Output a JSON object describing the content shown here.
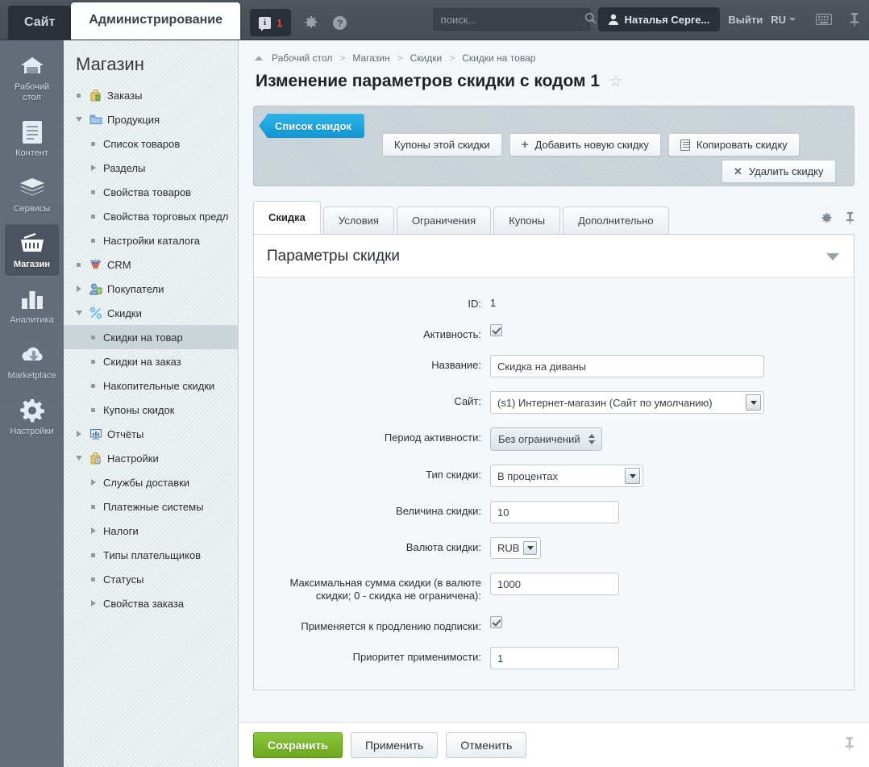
{
  "topbar": {
    "site_tab": "Сайт",
    "admin_tab": "Администрирование",
    "notification_count": "1",
    "notification_icon": "info-icon",
    "gear_icon": "gear-icon",
    "help_icon": "help-icon",
    "search_placeholder": "поиск...",
    "search_value": "",
    "search_icon": "search-icon",
    "user_name": "Наталья Серге...",
    "user_icon": "user-icon",
    "logout": "Выйти",
    "language": "RU",
    "keyboard_icon": "keyboard-icon",
    "pin_icon": "pin-icon"
  },
  "rail": {
    "items": [
      {
        "label": "Рабочий стол",
        "icon": "home-icon",
        "active": false
      },
      {
        "label": "Контент",
        "icon": "document-icon",
        "active": false
      },
      {
        "label": "Сервисы",
        "icon": "layers-icon",
        "active": false
      },
      {
        "label": "Магазин",
        "icon": "basket-icon",
        "active": true
      },
      {
        "label": "Аналитика",
        "icon": "bar-chart-icon",
        "active": false
      },
      {
        "label": "Marketplace",
        "icon": "cloud-download-icon",
        "active": false
      },
      {
        "label": "Настройки",
        "icon": "gear-icon",
        "active": false
      }
    ]
  },
  "tree": {
    "title": "Магазин",
    "nodes": [
      {
        "label": "Заказы",
        "level": 1,
        "mark": "dot",
        "icon": "bag-icon",
        "selected": false
      },
      {
        "label": "Продукция",
        "level": 1,
        "mark": "tri-down",
        "icon": "folder-icon",
        "selected": false
      },
      {
        "label": "Список товаров",
        "level": 2,
        "mark": "dot",
        "icon": "",
        "selected": false
      },
      {
        "label": "Разделы",
        "level": 2,
        "mark": "tri-right",
        "icon": "",
        "selected": false
      },
      {
        "label": "Свойства товаров",
        "level": 2,
        "mark": "dot",
        "icon": "",
        "selected": false
      },
      {
        "label": "Свойства торговых предл",
        "level": 2,
        "mark": "dot",
        "icon": "",
        "selected": false
      },
      {
        "label": "Настройки каталога",
        "level": 2,
        "mark": "dot",
        "icon": "",
        "selected": false
      },
      {
        "label": "CRM",
        "level": 1,
        "mark": "dot",
        "icon": "funnel-icon",
        "selected": false
      },
      {
        "label": "Покупатели",
        "level": 1,
        "mark": "tri-right",
        "icon": "users-icon",
        "selected": false
      },
      {
        "label": "Скидки",
        "level": 1,
        "mark": "tri-down",
        "icon": "percent-icon",
        "selected": false
      },
      {
        "label": "Скидки на товар",
        "level": 2,
        "mark": "dot",
        "icon": "",
        "selected": true
      },
      {
        "label": "Скидки на заказ",
        "level": 2,
        "mark": "dot",
        "icon": "",
        "selected": false
      },
      {
        "label": "Накопительные скидки",
        "level": 2,
        "mark": "dot",
        "icon": "",
        "selected": false
      },
      {
        "label": "Купоны скидок",
        "level": 2,
        "mark": "dot",
        "icon": "",
        "selected": false
      },
      {
        "label": "Отчёты",
        "level": 1,
        "mark": "tri-right",
        "icon": "report-icon",
        "selected": false
      },
      {
        "label": "Настройки",
        "level": 1,
        "mark": "tri-down",
        "icon": "settings-bag-icon",
        "selected": false
      },
      {
        "label": "Службы доставки",
        "level": 2,
        "mark": "tri-right",
        "icon": "",
        "selected": false
      },
      {
        "label": "Платежные системы",
        "level": 2,
        "mark": "dot",
        "icon": "",
        "selected": false
      },
      {
        "label": "Налоги",
        "level": 2,
        "mark": "tri-right",
        "icon": "",
        "selected": false
      },
      {
        "label": "Типы плательщиков",
        "level": 2,
        "mark": "dot",
        "icon": "",
        "selected": false
      },
      {
        "label": "Статусы",
        "level": 2,
        "mark": "dot",
        "icon": "",
        "selected": false
      },
      {
        "label": "Свойства заказа",
        "level": 2,
        "mark": "tri-right",
        "icon": "",
        "selected": false
      }
    ]
  },
  "breadcrumb": {
    "up_icon": "triangle-up-icon",
    "items": [
      "Рабочий стол",
      "Магазин",
      "Скидки",
      "Скидки на товар"
    ],
    "separator": ">"
  },
  "page": {
    "title": "Изменение параметров скидки с кодом 1",
    "favorite_icon": "star-icon"
  },
  "toolbar": {
    "back_button": "Список скидок",
    "coupons_button": "Купоны этой скидки",
    "add_button": "Добавить новую скидку",
    "copy_button": "Копировать скидку",
    "delete_button": "Удалить скидку",
    "add_icon": "plus-icon",
    "copy_icon": "copy-icon",
    "delete_icon": "close-icon"
  },
  "tabs": {
    "items": [
      {
        "label": "Скидка",
        "active": true
      },
      {
        "label": "Условия",
        "active": false
      },
      {
        "label": "Ограничения",
        "active": false
      },
      {
        "label": "Купоны",
        "active": false
      },
      {
        "label": "Дополнительно",
        "active": false
      }
    ],
    "settings_icon": "gear-icon",
    "pin_icon": "pin-icon"
  },
  "form": {
    "section_title": "Параметры скидки",
    "collapse_icon": "chevron-down-icon",
    "fields": {
      "id_label": "ID:",
      "id_value": "1",
      "active_label": "Активность:",
      "active_checked": true,
      "name_label": "Название:",
      "name_value": "Скидка на диваны",
      "site_label": "Сайт:",
      "site_value": "(s1) Интернет-магазин (Сайт по умолчанию)",
      "period_label": "Период активности:",
      "period_value": "Без ограничений",
      "type_label": "Тип скидки:",
      "type_value": "В процентах",
      "amount_label": "Величина скидки:",
      "amount_value": "10",
      "currency_label": "Валюта скидки:",
      "currency_value": "RUB",
      "max_label_line1": "Максимальная сумма скидки (в валюте",
      "max_label_line2": "скидки; 0 - скидка не ограничена):",
      "max_value": "1000",
      "renew_label": "Применяется к продлению подписки:",
      "renew_checked": true,
      "priority_label": "Приоритет применимости:",
      "priority_value": "1"
    }
  },
  "footer": {
    "save": "Сохранить",
    "apply": "Применить",
    "cancel": "Отменить",
    "pin_icon": "pin-icon"
  },
  "colors": {
    "accent_blue": "#0f97d4",
    "save_green": "#6ca81e",
    "notif_red": "#e74c3c",
    "rail_bg": "#606b78",
    "tree_bg": "#e3eaec"
  }
}
